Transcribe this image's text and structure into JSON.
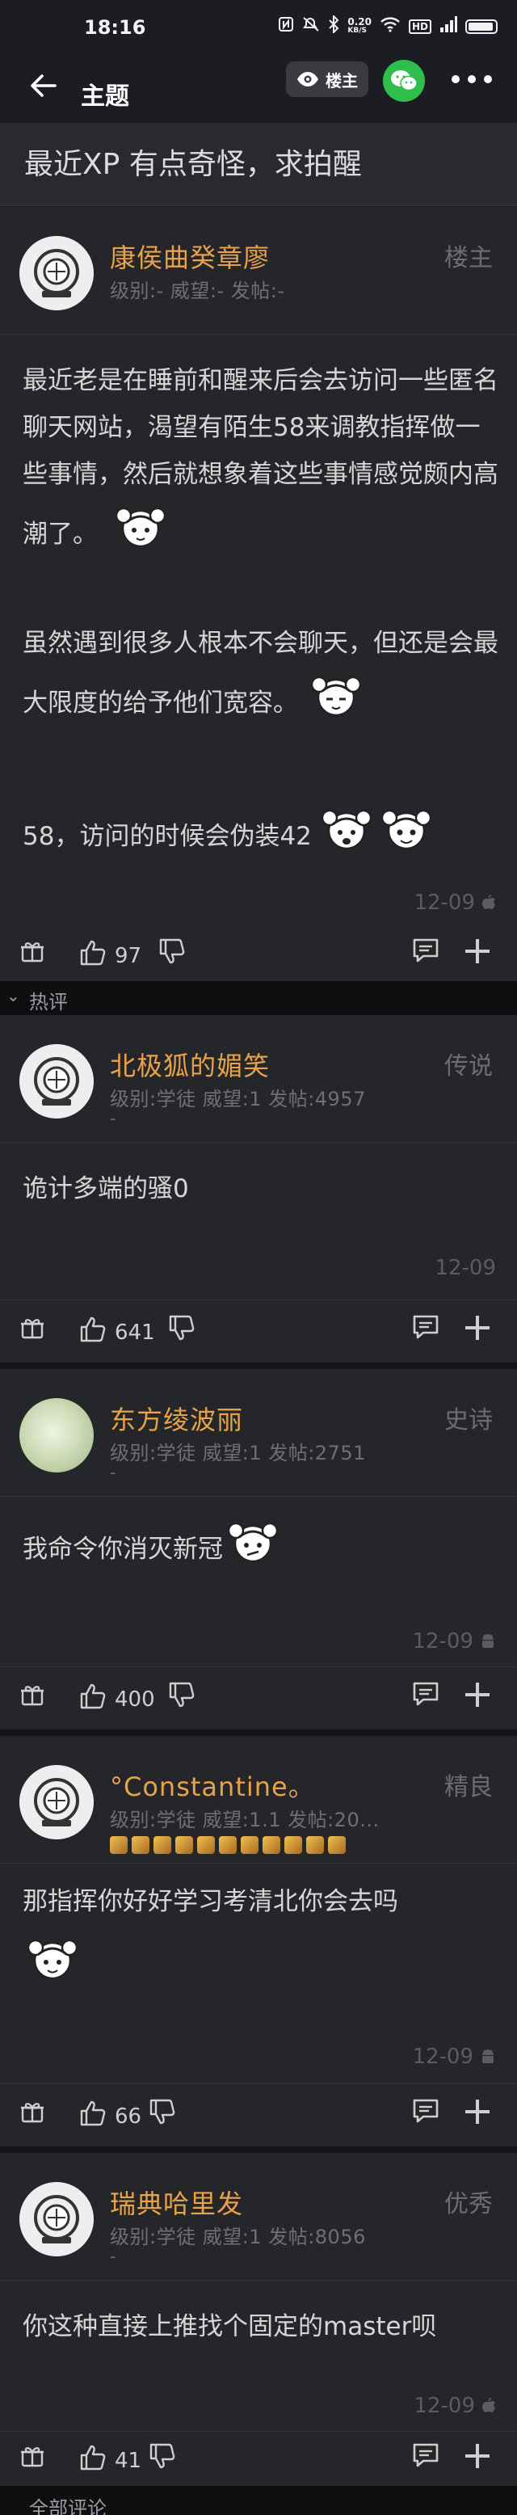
{
  "status_bar": {
    "time": "18:16",
    "net_speed_value": "0.20",
    "net_speed_unit": "KB/S",
    "hd_label": "HD"
  },
  "nav": {
    "title": "主题",
    "op_label": "楼主"
  },
  "thread": {
    "title": "最近XP 有点奇怪，求拍醒"
  },
  "sections": {
    "hot": "热评",
    "all": "全部评论"
  },
  "posts": [
    {
      "username": "康侯曲癸章廖",
      "meta": "级别:- 威望:- 发帖:-",
      "meta2": "",
      "role": "楼主",
      "paragraphs": [
        "最近老是在睡前和醒来后会去访问一些匿名聊天网站，渴望有陌生58来调教指挥做一些事情，然后就想象着这些事情感觉颇内高潮了。",
        "虽然遇到很多人根本不会聊天，但还是会最大限度的给予他们宽容。",
        "58，访问的时候会伪装42"
      ],
      "date": "12-09",
      "likes": "97"
    },
    {
      "username": "北极狐的媚笑",
      "meta": "级别:学徒 威望:1 发帖:4957",
      "meta2": "-",
      "role": "传说",
      "paragraphs": [
        "诡计多端的骚0"
      ],
      "date": "12-09",
      "likes": "641"
    },
    {
      "username": "东方绫波丽",
      "meta": "级别:学徒 威望:1 发帖:2751",
      "meta2": "-",
      "role": "史诗",
      "paragraphs": [
        "我命令你消灭新冠"
      ],
      "date": "12-09",
      "likes": "400"
    },
    {
      "username": "°Constantine。",
      "meta": "级别:学徒 威望:1.1 发帖:20...",
      "meta2": "",
      "role": "精良",
      "paragraphs": [
        "那指挥你好好学习考清北你会去吗"
      ],
      "date": "12-09",
      "likes": "66"
    },
    {
      "username": "瑞典哈里发",
      "meta": "级别:学徒 威望:1 发帖:8056",
      "meta2": "-",
      "role": "优秀",
      "paragraphs": [
        "你这种直接上推找个固定的master呗"
      ],
      "date": "12-09",
      "likes": "41"
    }
  ],
  "colors": {
    "background": "#1b1c21",
    "card": "#252629",
    "username": "#e8a24a",
    "wechat": "#2fbd4c"
  },
  "icons": [
    "back-arrow-icon",
    "eye-icon",
    "wechat-icon",
    "more-icon",
    "gift-icon",
    "thumbs-up-icon",
    "thumbs-down-icon",
    "comment-icon",
    "plus-icon",
    "apple-icon",
    "android-icon",
    "mascot-sticker-icon"
  ]
}
